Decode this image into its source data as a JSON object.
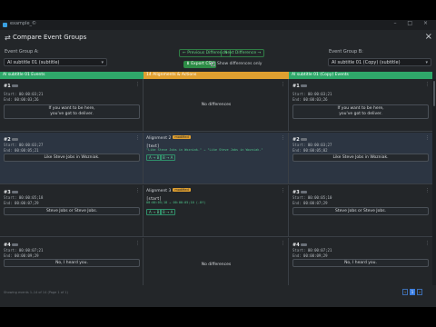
{
  "window": {
    "title": "example_©",
    "controls": "– □ ×"
  },
  "dialog": {
    "title": "Compare Event Groups",
    "close": "×",
    "icon": "compare-icon"
  },
  "group_a": {
    "label": "Event Group A:",
    "value": "AI subtitle 01 (subtitle)"
  },
  "group_b": {
    "label": "Event Group B:",
    "value": "AI subtitle 01 (Copy) (subtitle)"
  },
  "nav": {
    "previous": "← Previous Difference",
    "next": "Next Difference →"
  },
  "export": {
    "label": "⬇ Export CSV"
  },
  "show_diff_only": {
    "label": "Show differences only",
    "checked": false
  },
  "columns": {
    "a": "AI subtitle 01 Events",
    "middle": "14 Alignments & Actions",
    "b": "AI subtitle 01 (Copy) Events"
  },
  "rows": [
    {
      "a": {
        "num": "#1",
        "start": "00:00:03;21",
        "end": "00:00:03;26",
        "text": [
          "If you want to be here,",
          "you've got to deliver."
        ]
      },
      "middle": {
        "kind": "none",
        "text": "No differences"
      },
      "b": {
        "num": "#1",
        "start": "00:00:03;21",
        "end": "00:00:03;26",
        "text": [
          "If you want to be here,",
          "you've got to deliver."
        ]
      }
    },
    {
      "a": {
        "num": "#2",
        "start": "00:00:03;27",
        "end": "00:00:05;21",
        "text": [
          "Like Steve Jobs in Wozniak."
        ]
      },
      "middle": {
        "kind": "alignment",
        "title": "Alignment 2",
        "badge": "modified",
        "field": "[text]",
        "line": "\"Like Steve Jobs in Wozniak.\" → \"Like Steve Jobs in Wozniak.\"",
        "btn1": "A → B",
        "btn2": "B → A"
      },
      "b": {
        "num": "#2",
        "start": "00:00:03;27",
        "end": "00:00:05;02",
        "text": [
          "Like Steve Jobs in Wozniak."
        ]
      }
    },
    {
      "a": {
        "num": "#3",
        "start": "00:00:05;18",
        "end": "00:00:07;29",
        "text": [
          "Steve Jobs or Steve Jobs."
        ]
      },
      "middle": {
        "kind": "alignment",
        "title": "Alignment 3",
        "badge": "modified",
        "field": "[start]",
        "line": "00:00:05;18 → 00:00:05;10 (-8f)",
        "btn1": "A → B",
        "btn2": "B → A"
      },
      "b": {
        "num": "#3",
        "start": "00:00:05;10",
        "end": "00:00:07;29",
        "text": [
          "Steve Jobs or Steve Jobs."
        ]
      }
    },
    {
      "a": {
        "num": "#4",
        "start": "00:00:07;21",
        "end": "00:00:09;29",
        "text": [
          "No, I heard you."
        ]
      },
      "middle": {
        "kind": "none",
        "text": "No differences"
      },
      "b": {
        "num": "#4",
        "start": "00:00:07;21",
        "end": "00:00:09;29",
        "text": [
          "No, I heard you."
        ]
      }
    }
  ],
  "footer": {
    "text": "Showing events 1–14 of 14 (Page 1 of 1)"
  },
  "pager": {
    "prev": "‹",
    "page": "1",
    "next": "›"
  },
  "colors": {
    "green": "#2fa86a",
    "orange": "#e0a030",
    "accent": "#3a7de0"
  }
}
